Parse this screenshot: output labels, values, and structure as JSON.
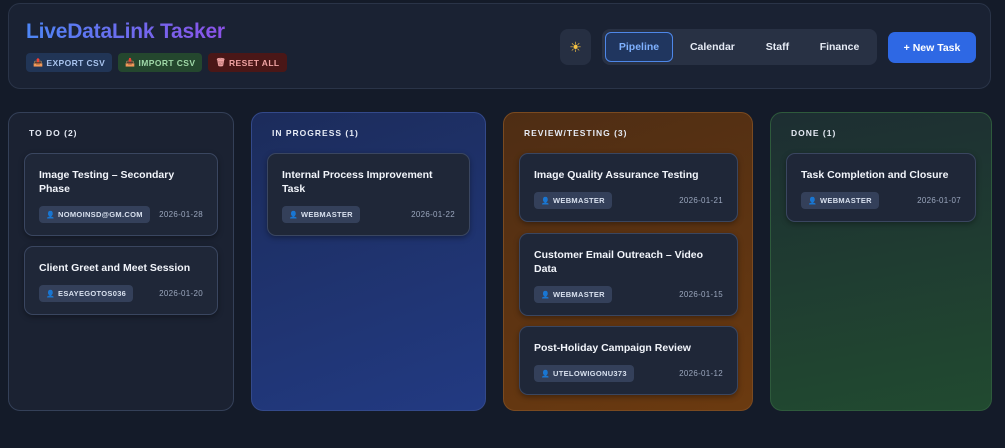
{
  "app": {
    "title": "LiveDataLink Tasker",
    "actions": {
      "export_label": "EXPORT CSV",
      "import_label": "IMPORT CSV",
      "reset_label": "RESET ALL"
    },
    "theme_toggle_icon": "sun-icon",
    "tabs": [
      {
        "label": "Pipeline",
        "active": true
      },
      {
        "label": "Calendar",
        "active": false
      },
      {
        "label": "Staff",
        "active": false
      },
      {
        "label": "Finance",
        "active": false
      }
    ],
    "new_task_label": "+ New Task"
  },
  "colors": {
    "accent": "#2e68e4",
    "todo_column": "#1b2232",
    "in_progress_column": "#223a82",
    "review_column": "#6b3a10",
    "done_column": "#214a30"
  },
  "columns": [
    {
      "title": "TO DO (2)",
      "cards": [
        {
          "title": "Image Testing – Secondary Phase",
          "assignee": "NOMOINSD@GM.COM",
          "date": "2026-01-28"
        },
        {
          "title": "Client Greet and Meet Session",
          "assignee": "ESAYEGOTOS036",
          "date": "2026-01-20"
        }
      ]
    },
    {
      "title": "IN PROGRESS (1)",
      "cards": [
        {
          "title": "Internal Process Improvement Task",
          "assignee": "WEBMASTER",
          "date": "2026-01-22"
        }
      ]
    },
    {
      "title": "REVIEW/TESTING (3)",
      "cards": [
        {
          "title": "Image Quality Assurance Testing",
          "assignee": "WEBMASTER",
          "date": "2026-01-21"
        },
        {
          "title": "Customer Email Outreach – Video Data",
          "assignee": "WEBMASTER",
          "date": "2026-01-15"
        },
        {
          "title": "Post-Holiday Campaign Review",
          "assignee": "UTELOWIGONU373",
          "date": "2026-01-12"
        }
      ]
    },
    {
      "title": "DONE (1)",
      "cards": [
        {
          "title": "Task Completion and Closure",
          "assignee": "WEBMASTER",
          "date": "2026-01-07"
        }
      ]
    }
  ]
}
